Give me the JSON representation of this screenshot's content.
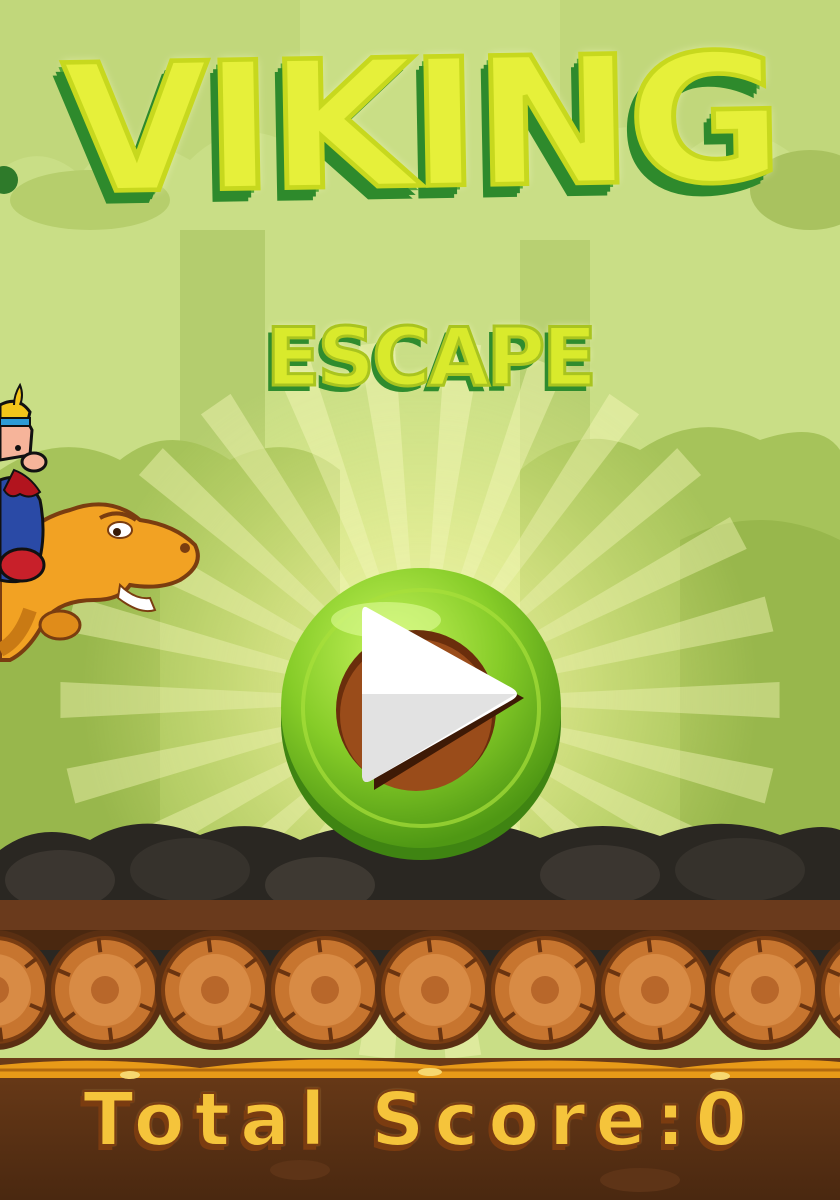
{
  "game": {
    "title": "VIKING",
    "subtitle": "ESCAPE",
    "score_label": "Total Score:",
    "score_value": "0"
  },
  "colors": {
    "sky": "#c9de86",
    "forest": "#a6c35a",
    "title_fill": "#e6f03a",
    "title_shadow": "#2e8a2c",
    "button_green": "#7cc624",
    "score_gold": "#f5c43b",
    "dirt": "#5b3317",
    "log": "#c7752f"
  },
  "icons": {
    "play": "play-icon",
    "character": "viking-on-dino"
  }
}
